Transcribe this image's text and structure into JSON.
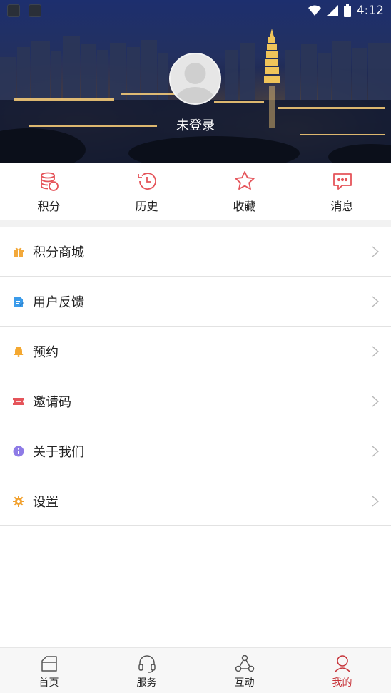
{
  "status_bar": {
    "time": "4:12"
  },
  "profile": {
    "login_status": "未登录"
  },
  "quick_actions": [
    {
      "label": "积分",
      "icon": "coins-icon",
      "color": "#e5545a"
    },
    {
      "label": "历史",
      "icon": "history-clock-icon",
      "color": "#e5545a"
    },
    {
      "label": "收藏",
      "icon": "star-icon",
      "color": "#e5545a"
    },
    {
      "label": "消息",
      "icon": "message-icon",
      "color": "#e5545a"
    }
  ],
  "menu": [
    {
      "label": "积分商城",
      "icon": "gift-icon",
      "color": "#f3a93b"
    },
    {
      "label": "用户反馈",
      "icon": "feedback-document-icon",
      "color": "#3b9bea"
    },
    {
      "label": "预约",
      "icon": "bell-icon",
      "color": "#f4a830"
    },
    {
      "label": "邀请码",
      "icon": "ticket-icon",
      "color": "#e5545a"
    },
    {
      "label": "关于我们",
      "icon": "info-icon",
      "color": "#8e7be6"
    },
    {
      "label": "设置",
      "icon": "gear-icon",
      "color": "#f1a12f"
    }
  ],
  "bottom_nav": [
    {
      "label": "首页",
      "icon": "home-icon",
      "active": false
    },
    {
      "label": "服务",
      "icon": "headset-icon",
      "active": false
    },
    {
      "label": "互动",
      "icon": "interaction-icon",
      "active": false
    },
    {
      "label": "我的",
      "icon": "user-icon",
      "active": true
    }
  ],
  "colors": {
    "accent": "#c7353b",
    "icon_red": "#e5545a",
    "divider": "#e2e2e2"
  }
}
